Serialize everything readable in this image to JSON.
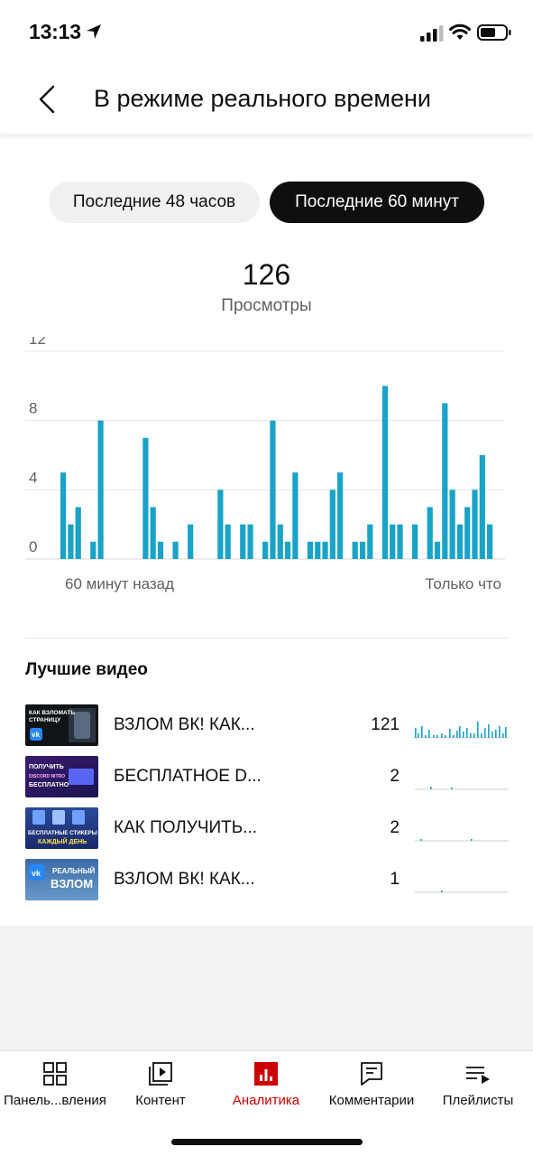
{
  "status": {
    "time": "13:13"
  },
  "header": {
    "title": "В режиме реального времени"
  },
  "filters": {
    "last48": "Последние 48 часов",
    "last60": "Последние 60 минут",
    "selected": "last60"
  },
  "summary": {
    "total": "126",
    "label": "Просмотры"
  },
  "chart_data": {
    "type": "bar",
    "title": "",
    "xlabel_start": "60 минут назад",
    "xlabel_end": "Только что",
    "ylabel": "",
    "ylim": [
      0,
      12
    ],
    "yticks": [
      0,
      4,
      8,
      12
    ],
    "grid": true,
    "color": "#19a3c8",
    "values": [
      5,
      2,
      3,
      0,
      1,
      8,
      0,
      0,
      0,
      0,
      0,
      7,
      3,
      1,
      0,
      1,
      0,
      2,
      0,
      0,
      0,
      4,
      2,
      0,
      2,
      2,
      0,
      1,
      8,
      2,
      1,
      5,
      0,
      1,
      1,
      1,
      4,
      5,
      0,
      1,
      1,
      2,
      0,
      10,
      2,
      2,
      0,
      2,
      0,
      3,
      1,
      9,
      4,
      2,
      3,
      4,
      6,
      2
    ]
  },
  "top_videos": {
    "title": "Лучшие видео",
    "items": [
      {
        "title": "ВЗЛОМ ВК! КАК...",
        "views": "121",
        "thumb_text": [
          "КАК ВЗЛОМАТЬ",
          "СТРАНИЦУ"
        ]
      },
      {
        "title": "БЕСПЛАТНОЕ D...",
        "views": "2",
        "thumb_text": [
          "ПОЛУЧИТЬ",
          "DISCORD NITRO",
          "БЕСПЛАТНО"
        ]
      },
      {
        "title": "КАК ПОЛУЧИТЬ...",
        "views": "2",
        "thumb_text": [
          "БЕСПЛАТНЫЕ СТИКЕРЫ",
          "КАЖДЫЙ ДЕНЬ"
        ]
      },
      {
        "title": "ВЗЛОМ ВК! КАК...",
        "views": "1",
        "thumb_text": [
          "РЕАЛЬНЫЙ",
          "ВЗЛОМ"
        ]
      }
    ]
  },
  "nav": {
    "items": [
      {
        "label": "Панель...вления",
        "icon": "dashboard-icon"
      },
      {
        "label": "Контент",
        "icon": "content-icon"
      },
      {
        "label": "Аналитика",
        "icon": "analytics-icon"
      },
      {
        "label": "Комментарии",
        "icon": "comments-icon"
      },
      {
        "label": "Плейлисты",
        "icon": "playlists-icon"
      }
    ],
    "active": 2,
    "active_color": "#cc0000"
  }
}
